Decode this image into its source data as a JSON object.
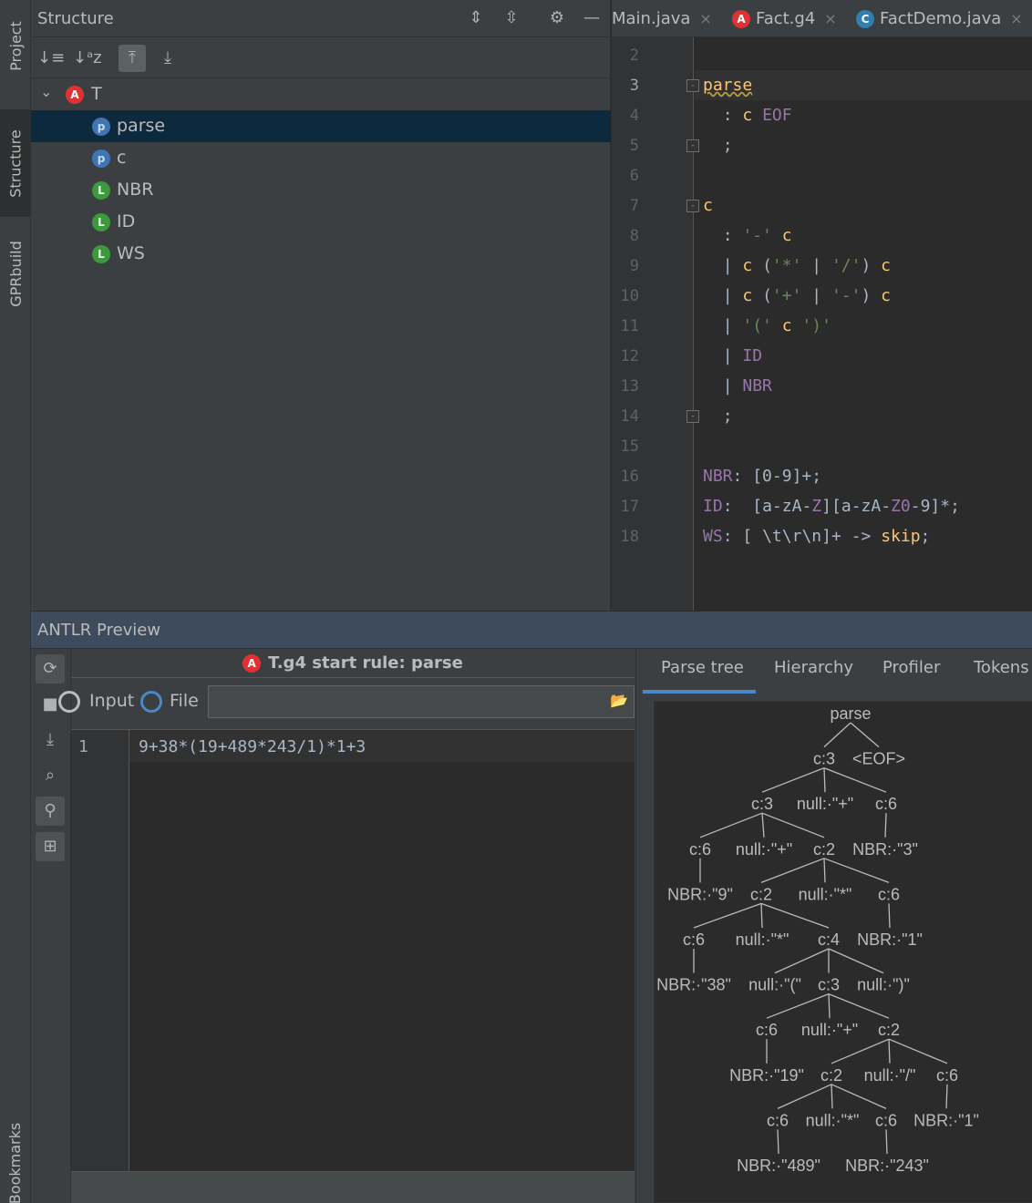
{
  "left_strip": {
    "tabs": [
      "Project",
      "Structure",
      "GPRbuild",
      "Bookmarks"
    ]
  },
  "structure": {
    "title": "Structure",
    "root": {
      "icon": "A",
      "label": "T"
    },
    "items": [
      {
        "icon": "p",
        "label": "parse",
        "selected": true
      },
      {
        "icon": "p",
        "label": "c",
        "selected": false
      },
      {
        "icon": "L",
        "label": "NBR",
        "selected": false
      },
      {
        "icon": "L",
        "label": "ID",
        "selected": false
      },
      {
        "icon": "L",
        "label": "WS",
        "selected": false
      }
    ]
  },
  "editor": {
    "tabs": [
      {
        "label": "Main.java",
        "icon": ""
      },
      {
        "label": "Fact.g4",
        "icon": "A"
      },
      {
        "label": "FactDemo.java",
        "icon": "C"
      }
    ],
    "close_glyph": "×",
    "lines": [
      {
        "n": "2",
        "code": ""
      },
      {
        "n": "3",
        "code": "parse"
      },
      {
        "n": "4",
        "code": "  : c EOF"
      },
      {
        "n": "5",
        "code": "  ;"
      },
      {
        "n": "6",
        "code": ""
      },
      {
        "n": "7",
        "code": "c"
      },
      {
        "n": "8",
        "code": "  : '-' c"
      },
      {
        "n": "9",
        "code": "  | c ('*' | '/') c"
      },
      {
        "n": "10",
        "code": "  | c ('+' | '-') c"
      },
      {
        "n": "11",
        "code": "  | '(' c ')'"
      },
      {
        "n": "12",
        "code": "  | ID"
      },
      {
        "n": "13",
        "code": "  | NBR"
      },
      {
        "n": "14",
        "code": "  ;"
      },
      {
        "n": "15",
        "code": ""
      },
      {
        "n": "16",
        "code": "NBR: [0-9]+;"
      },
      {
        "n": "17",
        "code": "ID:  [a-zA-Z][a-zA-Z0-9]*;"
      },
      {
        "n": "18",
        "code": "WS: [ \\t\\r\\n]+ -> skip;"
      }
    ]
  },
  "preview": {
    "title": "ANTLR Preview",
    "start_rule": "T.g4 start rule: parse",
    "input_label": "Input",
    "file_label": "File",
    "input_line_number": "1",
    "input_text": "9+38*(19+489*243/1)*1+3",
    "tabs": [
      "Parse tree",
      "Hierarchy",
      "Profiler",
      "Tokens"
    ],
    "tree_labels": {
      "n0": "parse",
      "n1": "c:3",
      "n2": "<EOF>",
      "n3": "c:3",
      "n4": "null:·\"+\"",
      "n5": "c:6",
      "n6": "c:6",
      "n7": "null:·\"+\"",
      "n8": "c:2",
      "n9": "NBR:·\"3\"",
      "n10": "NBR:·\"9\"",
      "n11": "c:2",
      "n12": "null:·\"*\"",
      "n13": "c:6",
      "n14": "c:6",
      "n15": "null:·\"*\"",
      "n16": "c:4",
      "n17": "NBR:·\"1\"",
      "n18": "NBR:·\"38\"",
      "n19": "null:·\"(\"",
      "n20": "c:3",
      "n21": "null:·\")\"",
      "n22": "c:6",
      "n23": "null:·\"+\"",
      "n24": "c:2",
      "n25": "NBR:·\"19\"",
      "n26": "c:2",
      "n27": "null:·\"/\"",
      "n28": "c:6",
      "n29": "c:6",
      "n30": "null:·\"*\"",
      "n31": "c:6",
      "n32": "NBR:·\"1\"",
      "n33": "NBR:·\"489\"",
      "n34": "NBR:·\"243\""
    }
  }
}
